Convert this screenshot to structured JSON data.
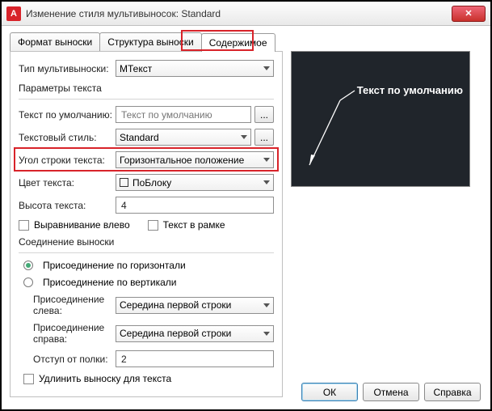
{
  "window": {
    "title": "Изменение стиля мультивыносок: Standard"
  },
  "tabs": {
    "t0": "Формат выноски",
    "t1": "Структура выноски",
    "t2": "Содержимое"
  },
  "mtype": {
    "label": "Тип мультивыноски:",
    "value": "МТекст"
  },
  "sec_text": "Параметры текста",
  "def_text": {
    "label": "Текст по умолчанию:",
    "placeholder": "Текст по умолчанию"
  },
  "tstyle": {
    "label": "Текстовый стиль:",
    "value": "Standard"
  },
  "angle": {
    "label": "Угол строки текста:",
    "value": "Горизонтальное положение"
  },
  "tcolor": {
    "label": "Цвет текста:",
    "value": "ПоБлоку"
  },
  "theight": {
    "label": "Высота текста:",
    "value": "4"
  },
  "chk_left": "Выравнивание влево",
  "chk_frame": "Текст в рамке",
  "sec_conn": "Соединение выноски",
  "conn_h": "Присоединение по горизонтали",
  "conn_v": "Присоединение по вертикали",
  "conn_left": {
    "label": "Присоединение слева:",
    "value": "Середина первой строки"
  },
  "conn_right": {
    "label": "Присоединение справа:",
    "value": "Середина первой строки"
  },
  "gap": {
    "label": "Отступ от полки:",
    "value": "2"
  },
  "chk_extend": "Удлинить выноску для текста",
  "preview_text": "Текст по умолчанию",
  "buttons": {
    "ok": "ОК",
    "cancel": "Отмена",
    "help": "Справка"
  },
  "ellipsis": "..."
}
